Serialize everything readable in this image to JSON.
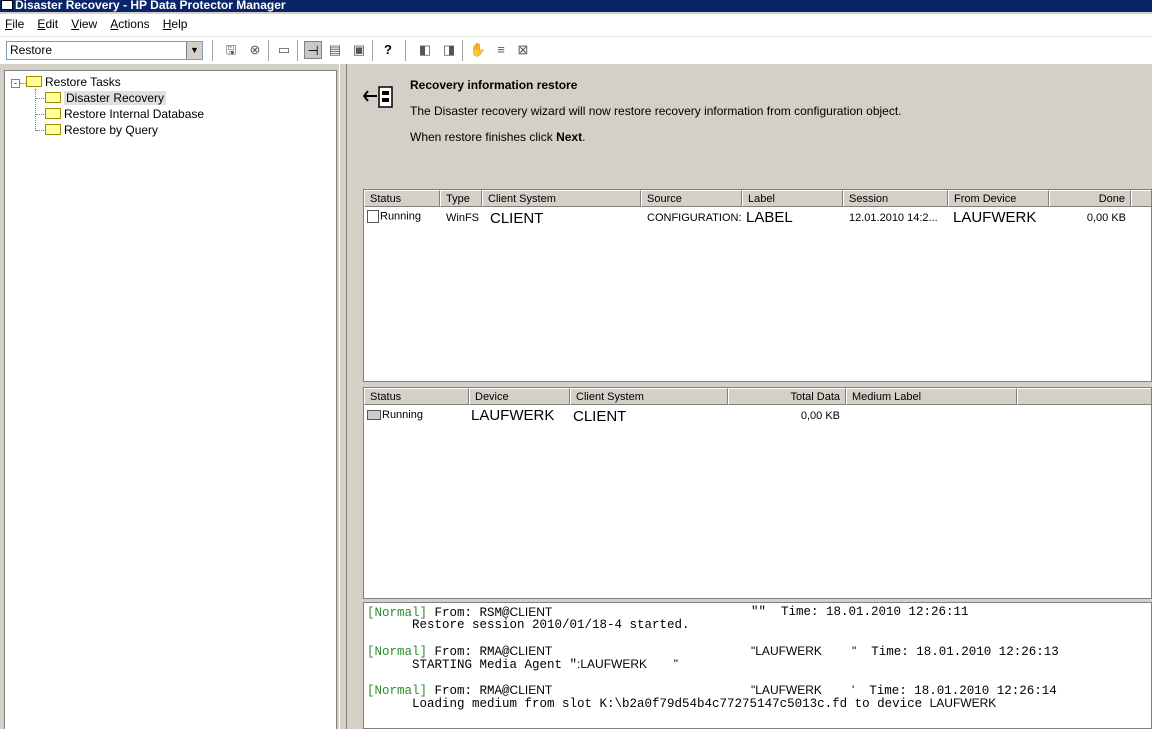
{
  "window": {
    "title": "Disaster Recovery - HP Data Protector Manager"
  },
  "menu": [
    {
      "label": "File",
      "key": "F",
      "rest": "ile"
    },
    {
      "label": "Edit",
      "key": "E",
      "rest": "dit"
    },
    {
      "label": "View",
      "key": "V",
      "rest": "iew"
    },
    {
      "label": "Actions",
      "key": "A",
      "rest": "ctions"
    },
    {
      "label": "Help",
      "key": "H",
      "rest": "elp"
    }
  ],
  "toolbar": {
    "context_value": "Restore",
    "help_glyph": "?"
  },
  "tree": {
    "root": "Restore Tasks",
    "items": [
      "Disaster Recovery",
      "Restore Internal Database",
      "Restore by Query"
    ],
    "selected_index": 0
  },
  "wizard": {
    "title": "Recovery information restore",
    "description": "The Disaster recovery wizard will now restore recovery information from configuration object.",
    "next_prefix": "When restore finishes click ",
    "next_bold": "Next",
    "next_suffix": "."
  },
  "objects_table": {
    "headers": {
      "status": "Status",
      "type": "Type",
      "client": "Client System",
      "source": "Source",
      "label": "Label",
      "session": "Session",
      "device": "From Device",
      "done": "Done"
    },
    "rows": [
      {
        "status": "Running",
        "type": "WinFS",
        "client": "CLIENT",
        "source": "CONFIGURATION:",
        "label": "LABEL",
        "session": "12.01.2010 14:2...",
        "device": "LAUFWERK",
        "done": "0,00 KB"
      }
    ]
  },
  "devices_table": {
    "headers": {
      "status": "Status",
      "device": "Device",
      "client": "Client System",
      "total": "Total Data",
      "medium": "Medium Label"
    },
    "rows": [
      {
        "status": "Running",
        "device": "LAUFWERK",
        "client": "CLIENT",
        "total": "0,00 KB",
        "medium": ""
      }
    ]
  },
  "log": [
    {
      "level": "[Normal]",
      "from": " From: RSM@",
      "client": "CLIENT",
      "agent": "\"\"",
      "time": "  Time: 18.01.2010 12:26:11",
      "message": "      Restore session 2010/01/18-4 started."
    },
    {
      "level": "[Normal]",
      "from": " From: RMA@",
      "client": "CLIENT",
      "agent": "\"LAUFWERK         \"",
      "time": "  Time: 18.01.2010 12:26:13",
      "message_prefix": "      STARTING Media Agent \"",
      "message_device": ":LAUFWERK        \""
    },
    {
      "level": "[Normal]",
      "from": " From: RMA@",
      "client": "CLIENT",
      "agent": "\"LAUFWERK         '",
      "time": "  Time: 18.01.2010 12:26:14",
      "message_prefix": "      Loading medium from slot K:\\b2a0f79d54b4c77275147c5013c.fd to device ",
      "message_device": "LAUFWERK"
    }
  ]
}
